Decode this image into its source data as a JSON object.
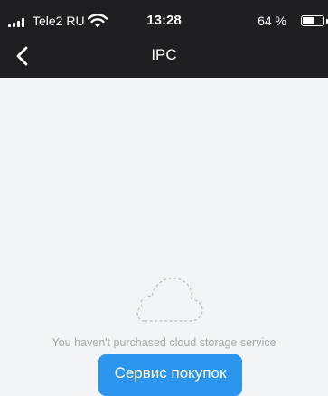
{
  "status_bar": {
    "carrier": "Tele2 RU",
    "time": "13:28",
    "battery_percent": "64 %",
    "battery_level": 0.64,
    "icons": [
      "signal-icon",
      "wifi-icon",
      "battery-icon"
    ]
  },
  "nav": {
    "title": "IPC",
    "back_icon": "chevron-left-icon"
  },
  "main": {
    "empty_icon": "cloud-outline-icon",
    "empty_message": "You haven't purchased cloud storage service",
    "purchase_button": "Сервис покупок"
  },
  "colors": {
    "header_bg": "#1f1f21",
    "page_bg": "#f3f4f6",
    "accent": "#2c95ee",
    "muted_text": "#a5a8ad"
  }
}
